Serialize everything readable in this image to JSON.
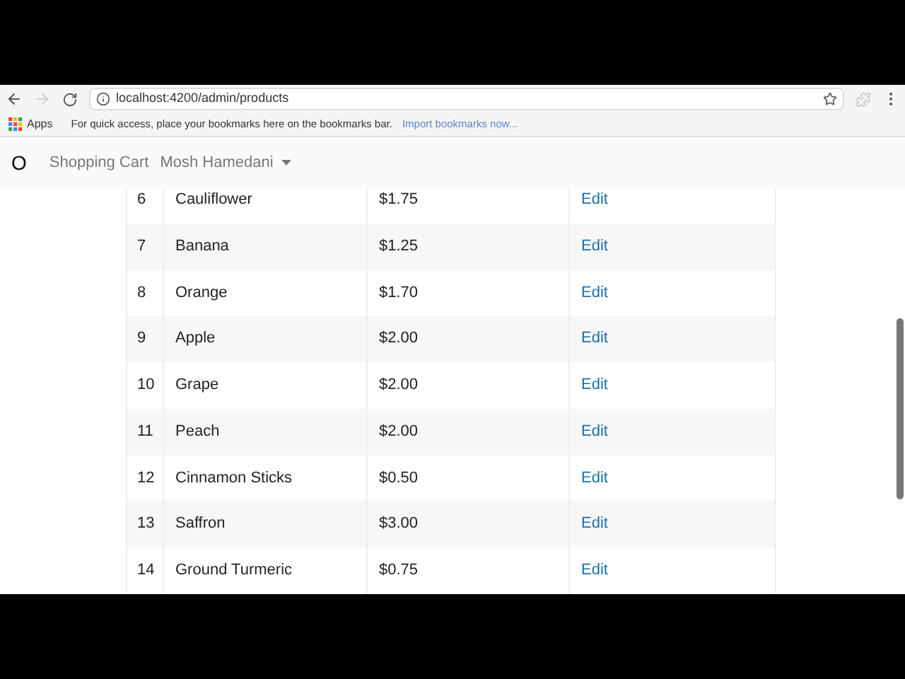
{
  "browser": {
    "url": "localhost:4200/admin/products",
    "forward_disabled": true
  },
  "bookmarks_bar": {
    "apps": "Apps",
    "message": "For quick access, place your bookmarks here on the bookmarks bar.",
    "import_link": "Import bookmarks now..."
  },
  "navbar": {
    "brand": "O",
    "links": [
      "Shopping Cart"
    ],
    "user_menu": "Mosh Hamedani"
  },
  "table": {
    "rows": [
      {
        "number": "6",
        "title": "Cauliflower",
        "price": "$1.75",
        "action": "Edit"
      },
      {
        "number": "7",
        "title": "Banana",
        "price": "$1.25",
        "action": "Edit"
      },
      {
        "number": "8",
        "title": "Orange",
        "price": "$1.70",
        "action": "Edit"
      },
      {
        "number": "9",
        "title": "Apple",
        "price": "$2.00",
        "action": "Edit"
      },
      {
        "number": "10",
        "title": "Grape",
        "price": "$2.00",
        "action": "Edit"
      },
      {
        "number": "11",
        "title": "Peach",
        "price": "$2.00",
        "action": "Edit"
      },
      {
        "number": "12",
        "title": "Cinnamon Sticks",
        "price": "$0.50",
        "action": "Edit"
      },
      {
        "number": "13",
        "title": "Saffron",
        "price": "$3.00",
        "action": "Edit"
      },
      {
        "number": "14",
        "title": "Ground Turmeric",
        "price": "$0.75",
        "action": "Edit"
      }
    ]
  }
}
